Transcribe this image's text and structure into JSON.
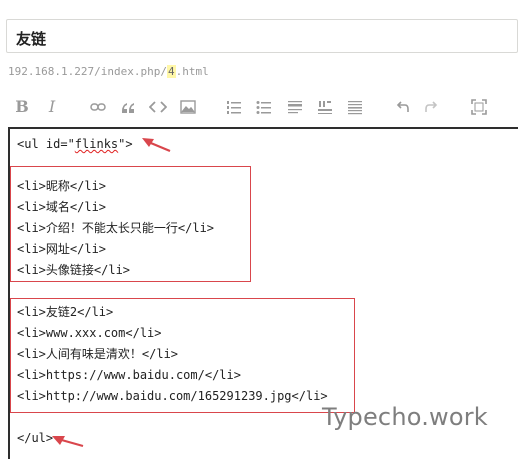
{
  "post": {
    "title": "友链"
  },
  "permalink": {
    "prefix": "192.168.1.227/index.php/",
    "slug": "4",
    "suffix": ".html"
  },
  "toolbar": {
    "bold_label": "B",
    "italic_label": "I",
    "buttons": [
      "bold",
      "italic",
      "link",
      "quote",
      "code",
      "image",
      "ordered-list",
      "unordered-list",
      "heading",
      "horizontal-rule",
      "more",
      "undo",
      "redo",
      "fullscreen"
    ]
  },
  "editor": {
    "lines": [
      "<ul id=\"",
      "flinks",
      "\">",
      "<li>昵称</li>",
      "<li>域名</li>",
      "<li>介绍！不能太长只能一行</li>",
      "<li>网址</li>",
      "<li>头像链接</li>",
      "<li>友链2</li>",
      "<li>www.xxx.com</li>",
      "<li>人间有味是清欢！</li>",
      "<li>https://www.baidu.com/</li>",
      "<li>http://www.baidu.com/165291239.jpg</li>",
      "</ul>"
    ]
  },
  "watermark": "Typecho.work",
  "colors": {
    "annotation_red": "#d9464c",
    "slug_highlight": "#fff7a8",
    "editor_border": "#2e2e2e",
    "toolbar_icon": "#9a9a9a"
  }
}
